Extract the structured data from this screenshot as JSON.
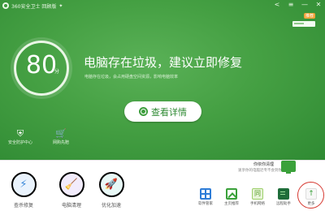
{
  "window": {
    "title": "360安全卫士 回顾版",
    "title_badge": "✦"
  },
  "controls": {
    "share": "<",
    "menu": "≡",
    "minimize": "—",
    "close": "✕"
  },
  "promo": {
    "badge": "推荐"
  },
  "score": {
    "value": "80",
    "unit": "分"
  },
  "status": {
    "title": "电脑存在垃圾，建议立即修复",
    "subtitle": "电脑存在垃圾，会占用硬盘空间资源，影响电脑效率"
  },
  "primary_action": {
    "label": "查看详情"
  },
  "mini_tools": [
    {
      "label": "安全防护中心",
      "icon": "shield-icon"
    },
    {
      "label": "网购先赔",
      "icon": "cart-icon"
    }
  ],
  "features": [
    {
      "label": "查杀修复",
      "icon": "lightning-icon"
    },
    {
      "label": "电脑清理",
      "icon": "broom-icon"
    },
    {
      "label": "优化加速",
      "icon": "rocket-icon"
    }
  ],
  "side_promo": {
    "title": "你依你清理",
    "subtitle": "速享你的电脑近专不会到你的电脑"
  },
  "app_tiles": [
    {
      "label": "软件管家",
      "icon": "apps-icon"
    },
    {
      "label": "主页推荐",
      "icon": "home-icon"
    },
    {
      "label": "手机网络",
      "icon": "network-icon",
      "glyph": "同"
    },
    {
      "label": "远程助手",
      "icon": "remote-icon"
    },
    {
      "label": "更多",
      "icon": "more-icon",
      "glyph": "↑"
    }
  ],
  "colors": {
    "brand_green": "#45a043",
    "accent_red": "#d63a32"
  }
}
